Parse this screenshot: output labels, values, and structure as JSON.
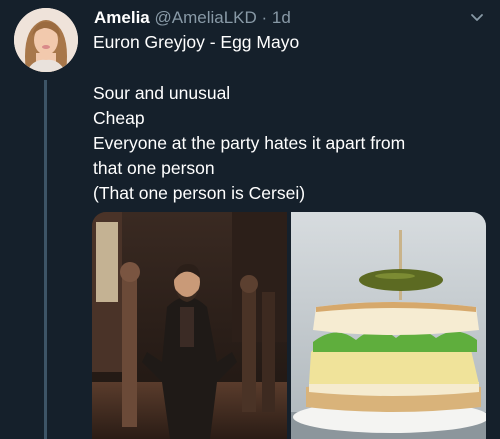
{
  "tweet": {
    "display_name": "Amelia",
    "handle": "@AmeliaLKD",
    "separator": "·",
    "time": "1d",
    "lines": [
      "Euron Greyjoy - Egg Mayo",
      "",
      "Sour and unusual",
      "Cheap",
      "Everyone at the party hates it apart from",
      "that one person",
      "(That one person is Cersei)"
    ]
  },
  "icons": {
    "menu": "chevron-down-icon"
  },
  "colors": {
    "background": "#15202b",
    "secondary_text": "#8899a6",
    "thread_line": "#3d5466"
  }
}
